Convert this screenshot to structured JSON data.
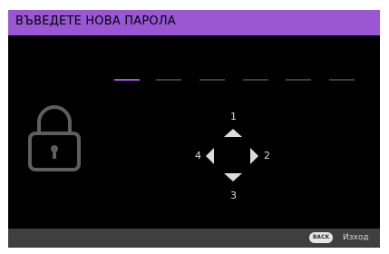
{
  "header": {
    "title": "ВЪВЕДЕТЕ НОВА ПАРОЛА"
  },
  "password": {
    "total_digits": 6,
    "entered_digits": 0
  },
  "icons": {
    "lock": "lock-icon"
  },
  "keypad": {
    "up": "1",
    "right": "2",
    "down": "3",
    "left": "4"
  },
  "footer": {
    "back_key": "BACK",
    "exit_label": "Изход"
  },
  "colors": {
    "accent": "#9b57d3",
    "background": "#000000",
    "footer": "#3f3f3f",
    "slot_inactive": "#3e3e3e"
  }
}
